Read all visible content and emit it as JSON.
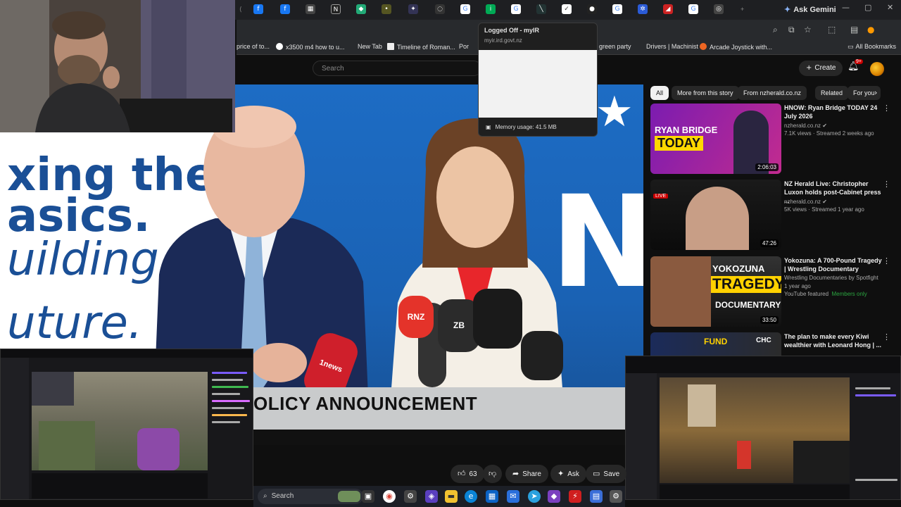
{
  "browser": {
    "ask_gemini_label": "Ask Gemini",
    "bookmarks": [
      {
        "label": "price of to...",
        "icon": "page-icon"
      },
      {
        "label": "x3500 m4 how to u...",
        "icon": "google-icon"
      },
      {
        "label": "New Tab",
        "icon": "newtab-icon"
      },
      {
        "label": "Timeline of Roman...",
        "icon": "wikipedia-icon"
      },
      {
        "label": "Por",
        "icon": "page-icon"
      },
      {
        "label": "green party",
        "icon": "page-icon"
      },
      {
        "label": "Drivers | Machinist",
        "icon": "page-icon"
      },
      {
        "label": "Arcade Joystick with...",
        "icon": "aliexpress-icon"
      }
    ],
    "all_bookmarks_label": "All Bookmarks"
  },
  "tooltip": {
    "title": "Logged Off - myIR",
    "url": "myir.ird.govt.nz",
    "memory": "Memory usage: 41.5 MB"
  },
  "youtube": {
    "search_placeholder": "Search",
    "create_label": "Create",
    "notification_count": "9+",
    "chips": [
      "All",
      "More from this story",
      "From nzherald.co.nz",
      "Related",
      "For you"
    ],
    "recommendations": [
      {
        "title": "HNOW: Ryan Bridge TODAY 24 July 2026",
        "channel": "nzherald.co.nz",
        "meta": "7.1K views · Streamed 2 weeks ago",
        "duration": "2:06:03",
        "thumb_text_1": "RYAN BRIDGE",
        "thumb_text_2": "TODAY"
      },
      {
        "title": "NZ Herald Live: Christopher Luxon holds post-Cabinet press ...",
        "channel": "nzherald.co.nz",
        "meta": "5K views · Streamed 1 year ago",
        "duration": "47:26",
        "badge": "LIVE"
      },
      {
        "title": "Yokozuna: A 700-Pound Tragedy | Wrestling Documentary",
        "channel": "Wrestling Documentaries by Spotfight",
        "meta": "1 year ago",
        "featured": "YouTube featured",
        "members": "Members only",
        "duration": "33:50",
        "thumb_text_1": "YOKOZUNA",
        "thumb_text_2": "TRAGEDY",
        "thumb_text_3": "DOCUMENTARY"
      },
      {
        "title": "The plan to make every Kiwi wealthier with Leonard Hong | ...",
        "thumb_text_1": "FUND",
        "thumb_text_2": "CHC"
      }
    ],
    "actions": {
      "like_count": "63",
      "share_label": "Share",
      "ask_label": "Ask",
      "save_label": "Save"
    }
  },
  "video": {
    "backdrop_lines": [
      "xing the",
      "asics.",
      "uilding th",
      "uture."
    ],
    "lower_third": "OLICY ANNOUNCEMENT",
    "mic_labels": [
      "RNZ",
      "ZB",
      "1news"
    ]
  },
  "taskbar": {
    "search_label": "Search"
  },
  "colors": {
    "youtube_bg": "#0f0f0f",
    "backdrop_blue": "#1d6cc4",
    "members_green": "#2ba640",
    "chip_active": "#f1f1f1"
  }
}
